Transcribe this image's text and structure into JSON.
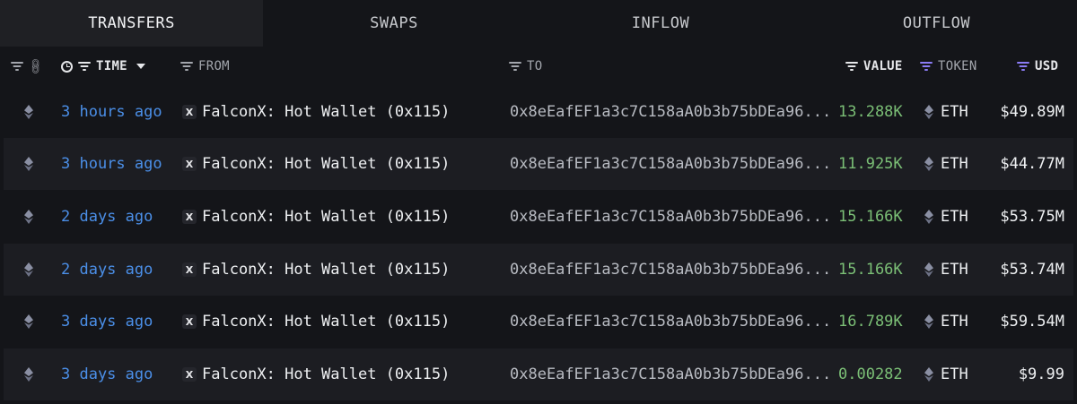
{
  "tabs": [
    {
      "label": "TRANSFERS",
      "active": true
    },
    {
      "label": "SWAPS",
      "active": false
    },
    {
      "label": "INFLOW",
      "active": false
    },
    {
      "label": "OUTFLOW",
      "active": false
    }
  ],
  "columns": {
    "time": "TIME",
    "from": "FROM",
    "to": "TO",
    "value": "VALUE",
    "token": "TOKEN",
    "usd": "USD"
  },
  "icons": {
    "chain": "ethereum-icon",
    "entity": "falconx-icon",
    "filter": "filter-icon",
    "link": "link-icon",
    "clock": "clock-icon",
    "sort": "caret-down-icon"
  },
  "colors": {
    "time": "#4b8fe8",
    "value": "#7bbf76",
    "active_filter": "#8b7cf6"
  },
  "rows": [
    {
      "time": "3 hours ago",
      "entity_mark": "X",
      "from": "FalconX: Hot Wallet (0x115)",
      "to": "0x8eEafEF1a3c7C158aA0b3b75bDEa96...",
      "value": "13.288K",
      "token": "ETH",
      "usd": "$49.89M"
    },
    {
      "time": "3 hours ago",
      "entity_mark": "X",
      "from": "FalconX: Hot Wallet (0x115)",
      "to": "0x8eEafEF1a3c7C158aA0b3b75bDEa96...",
      "value": "11.925K",
      "token": "ETH",
      "usd": "$44.77M"
    },
    {
      "time": "2 days ago",
      "entity_mark": "X",
      "from": "FalconX: Hot Wallet (0x115)",
      "to": "0x8eEafEF1a3c7C158aA0b3b75bDEa96...",
      "value": "15.166K",
      "token": "ETH",
      "usd": "$53.75M"
    },
    {
      "time": "2 days ago",
      "entity_mark": "X",
      "from": "FalconX: Hot Wallet (0x115)",
      "to": "0x8eEafEF1a3c7C158aA0b3b75bDEa96...",
      "value": "15.166K",
      "token": "ETH",
      "usd": "$53.74M"
    },
    {
      "time": "3 days ago",
      "entity_mark": "X",
      "from": "FalconX: Hot Wallet (0x115)",
      "to": "0x8eEafEF1a3c7C158aA0b3b75bDEa96...",
      "value": "16.789K",
      "token": "ETH",
      "usd": "$59.54M"
    },
    {
      "time": "3 days ago",
      "entity_mark": "X",
      "from": "FalconX: Hot Wallet (0x115)",
      "to": "0x8eEafEF1a3c7C158aA0b3b75bDEa96...",
      "value": "0.00282",
      "token": "ETH",
      "usd": "$9.99"
    }
  ]
}
